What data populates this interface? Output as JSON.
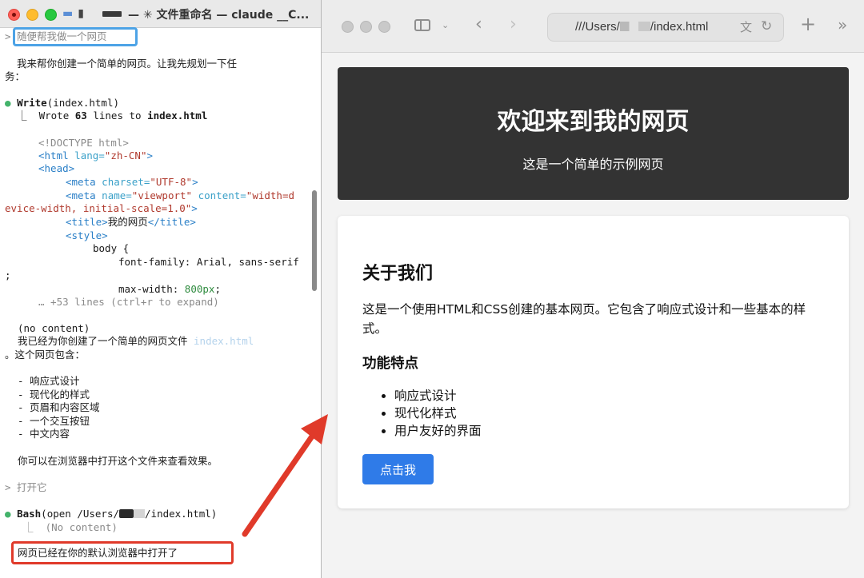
{
  "terminal": {
    "title": "— ✳ 文件重命名 — claude __C...",
    "lines": {
      "prompt1": "> 随便帮我做一个网页",
      "intro1": "  我来帮你创建一个简单的网页。让我先规划一下任",
      "intro2": "务：",
      "write_tool": "Write",
      "write_arg": "(index.html)",
      "wrote_prefix": "  ⎿  Wrote ",
      "wrote_count": "63",
      "wrote_mid": " lines to ",
      "wrote_file": "index.html",
      "code1": "<!DOCTYPE html>",
      "code2_tag": "<html",
      "code2_attr": " lang=",
      "code2_val": "\"zh-CN\"",
      "code2_end": ">",
      "code3": "<head>",
      "code4_tag": "<meta",
      "code4_attr": " charset=",
      "code4_val": "\"UTF-8\"",
      "code4_end": ">",
      "code5_tag": "<meta",
      "code5_attr": " name=",
      "code5_val": "\"viewport\"",
      "code5_attr2": " content=",
      "code5_val2": "\"width=d",
      "code6": "evice-width, initial-scale=1.0\"",
      "code6_end": ">",
      "code7_tag": "<title>",
      "code7_text": "我的网页",
      "code7_close": "</title>",
      "code8": "<style>",
      "code9": "body {",
      "code10": "font-family: Arial, sans-serif",
      "code11": ";",
      "code12_prop": "max-width: ",
      "code12_val": "800px",
      "code12_end": ";",
      "expand": "… +53 lines (ctrl+r to expand)",
      "no_content": "(no content)",
      "summary1": "我已经为你创建了一个简单的网页文件 ",
      "summary1_file": "index.html",
      "summary2": "。这个网页包含：",
      "feat1": "- 响应式设计",
      "feat2": "- 现代化的样式",
      "feat3": "- 页眉和内容区域",
      "feat4": "- 一个交互按钮",
      "feat5": "- 中文内容",
      "hint": "你可以在浏览器中打开这个文件来查看效果。",
      "prompt2": "> 打开它",
      "bash_tool": "Bash",
      "bash_arg1": "(open /Users/",
      "bash_arg2": "/index.html)",
      "bash_result": "  ⎿  (No content)",
      "final": "网页已经在你的默认浏览器中打开了"
    }
  },
  "browser": {
    "url_prefix": "///Users/",
    "url_suffix": "/index.html",
    "page": {
      "hero_title": "欢迎来到我的网页",
      "hero_subtitle": "这是一个简单的示例网页",
      "about_title": "关于我们",
      "about_text": "这是一个使用HTML和CSS创建的基本网页。它包含了响应式设计和一些基本的样式。",
      "features_title": "功能特点",
      "features": [
        "响应式设计",
        "现代化样式",
        "用户友好的界面"
      ],
      "button_label": "点击我"
    }
  },
  "colors": {
    "hero_bg": "#333333",
    "button_bg": "#2f7be8",
    "annotation_red": "#e03a2a",
    "annotation_blue": "#4da3e6"
  }
}
